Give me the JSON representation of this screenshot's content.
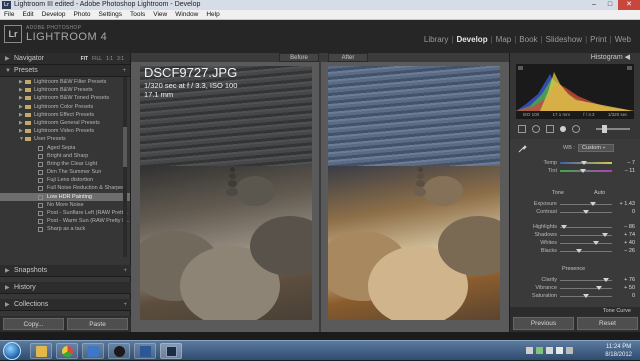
{
  "window": {
    "title": "Lightroom III edited - Adobe Photoshop Lightroom - Develop",
    "app_icon": "Lr",
    "controls": [
      "–",
      "□",
      "✕"
    ]
  },
  "menubar": [
    "File",
    "Edit",
    "Develop",
    "Photo",
    "Settings",
    "Tools",
    "View",
    "Window",
    "Help"
  ],
  "brand": {
    "logo": "Lr",
    "adobe": "ADOBE PHOTOSHOP",
    "product": "LIGHTROOM 4"
  },
  "modules": [
    {
      "label": "Library",
      "active": false
    },
    {
      "label": "Develop",
      "active": true
    },
    {
      "label": "Map",
      "active": false
    },
    {
      "label": "Book",
      "active": false
    },
    {
      "label": "Slideshow",
      "active": false
    },
    {
      "label": "Print",
      "active": false
    },
    {
      "label": "Web",
      "active": false
    }
  ],
  "left_panel": {
    "navigator": {
      "label": "Navigator",
      "options": [
        "FIT",
        "FILL",
        "1:1",
        "3:1"
      ],
      "active_option": "FIT"
    },
    "presets": {
      "label": "Presets",
      "add": "+"
    },
    "preset_items": [
      {
        "type": "folder",
        "label": "Lightroom B&W Filter Presets"
      },
      {
        "type": "folder",
        "label": "Lightroom B&W Presets"
      },
      {
        "type": "folder",
        "label": "Lightroom B&W Toned Presets"
      },
      {
        "type": "folder",
        "label": "Lightroom Color Presets"
      },
      {
        "type": "folder",
        "label": "Lightroom Effect Presets"
      },
      {
        "type": "folder",
        "label": "Lightroom General Presets"
      },
      {
        "type": "folder",
        "label": "Lightroom Video Presets"
      },
      {
        "type": "folder",
        "label": "User Presets",
        "open": true
      },
      {
        "type": "item",
        "label": "Aged Sepia"
      },
      {
        "type": "item",
        "label": "Bright and Sharp"
      },
      {
        "type": "item",
        "label": "Bring the Clear Light"
      },
      {
        "type": "item",
        "label": "Dim The Summer Sun"
      },
      {
        "type": "item",
        "label": "Fuji Lens distortion"
      },
      {
        "type": "item",
        "label": "Full Noise Reduction & Sharpen"
      },
      {
        "type": "item",
        "label": "Low HDR Painting",
        "selected": true
      },
      {
        "type": "item",
        "label": "No More Noise"
      },
      {
        "type": "item",
        "label": "Post - Sunflare Left (RAW Prett..."
      },
      {
        "type": "item",
        "label": "Post - Warm Sun (RAW Pretty P..."
      },
      {
        "type": "item",
        "label": "Sharp as a tack"
      }
    ],
    "lower_panels": [
      "Snapshots",
      "History",
      "Collections"
    ],
    "add_symbol": "+",
    "copy": "Copy...",
    "paste": "Paste"
  },
  "center": {
    "before_label": "Before",
    "after_label": "After",
    "filename": "DSCF9727.JPG",
    "exposure_info": "1/320 sec at f / 3.3, ISO 100",
    "focal_length": "17.1 mm"
  },
  "right_panel": {
    "histogram_label": "Histogram",
    "hist_info": [
      "ISO 100",
      "17.1 mm",
      "f / 3.3",
      "1/320 sec"
    ],
    "wb": {
      "label": "WB :",
      "value": "Custom ÷"
    },
    "tone_label": "Tone",
    "tone_auto": "Auto",
    "presence_label": "Presence",
    "sliders": [
      {
        "name": "Temp",
        "value": "– 7",
        "pos": 0.46,
        "kind": "temp"
      },
      {
        "name": "Tint",
        "value": "– 11",
        "pos": 0.44,
        "kind": "tint"
      },
      {
        "name": "Exposure",
        "value": "+ 1.43",
        "pos": 0.64,
        "kind": "plain"
      },
      {
        "name": "Contrast",
        "value": "0",
        "pos": 0.5,
        "kind": "plain"
      },
      {
        "name": "Highlights",
        "value": "– 86",
        "pos": 0.08,
        "kind": "plain"
      },
      {
        "name": "Shadows",
        "value": "+ 74",
        "pos": 0.86,
        "kind": "plain"
      },
      {
        "name": "Whites",
        "value": "+ 40",
        "pos": 0.7,
        "kind": "plain"
      },
      {
        "name": "Blacks",
        "value": "– 26",
        "pos": 0.37,
        "kind": "plain"
      },
      {
        "name": "Clarity",
        "value": "+ 76",
        "pos": 0.88,
        "kind": "plain"
      },
      {
        "name": "Vibrance",
        "value": "+ 50",
        "pos": 0.75,
        "kind": "plain"
      },
      {
        "name": "Saturation",
        "value": "0",
        "pos": 0.5,
        "kind": "plain"
      }
    ],
    "tone_curve_label": "Tone Curve",
    "previous": "Previous",
    "reset": "Reset"
  },
  "taskbar": {
    "apps": [
      "folder",
      "chrome",
      "media-player",
      "desktop-app",
      "word",
      "lightroom"
    ],
    "time": "11:24 PM",
    "date": "8/18/2012"
  }
}
